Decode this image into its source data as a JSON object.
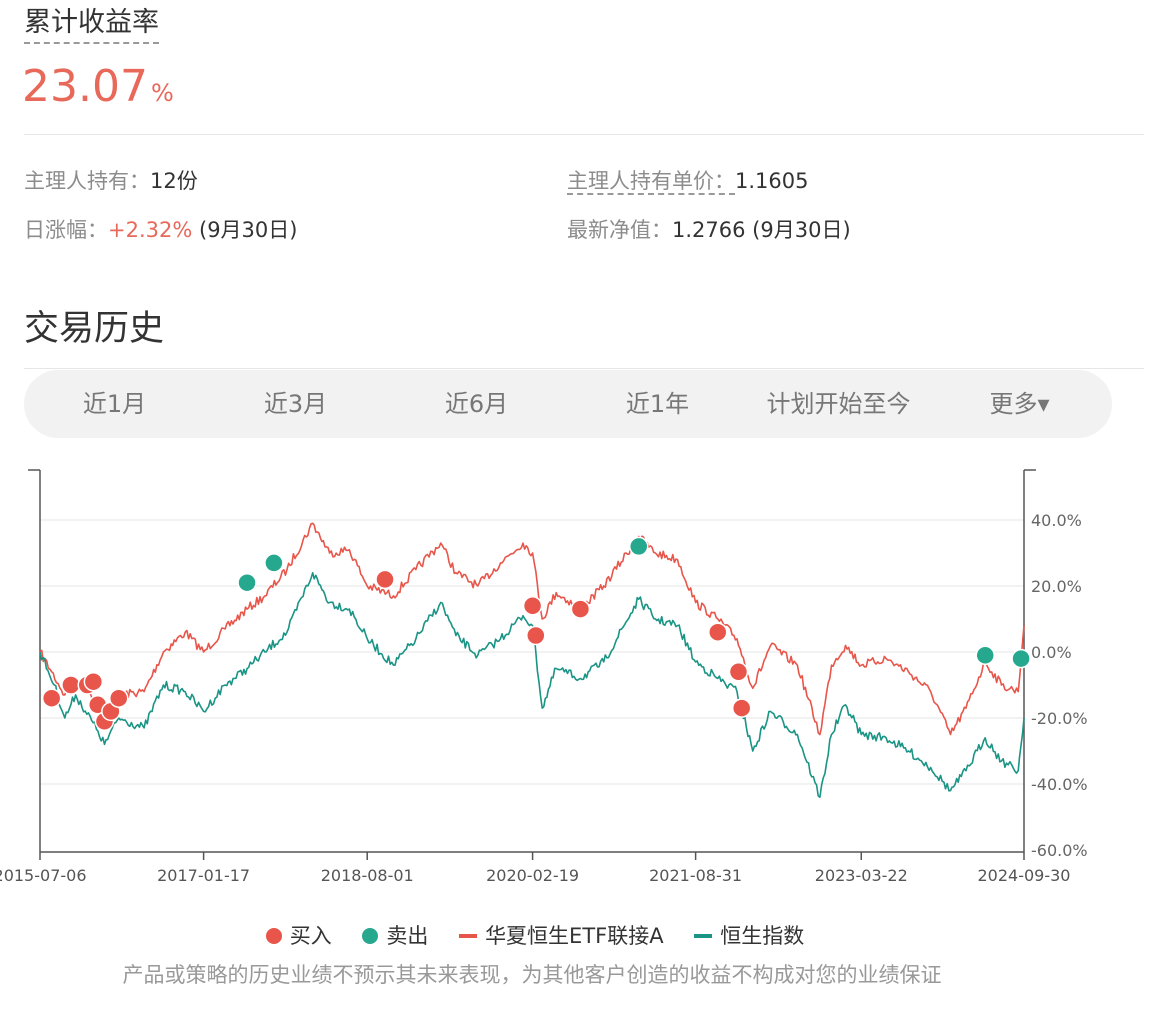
{
  "summary": {
    "title": "累计收益率",
    "return_value": "23.07",
    "return_unit": "%"
  },
  "stats": {
    "holding_label": "主理人持有：",
    "holding_value": "12份",
    "unit_price_label": "主理人持有单价：",
    "unit_price_value": "1.1605",
    "daily_label": "日涨幅：",
    "daily_value": "+2.32%",
    "daily_date": "(9月30日)",
    "nav_label": "最新净值：",
    "nav_value": "1.2766",
    "nav_date": "(9月30日)"
  },
  "section_title": "交易历史",
  "tabs": [
    "近1月",
    "近3月",
    "近6月",
    "近1年",
    "计划开始至今",
    "更多▾"
  ],
  "legend": {
    "buy": "买入",
    "sell": "卖出",
    "fund": "华夏恒生ETF联接A",
    "index": "恒生指数"
  },
  "disclaimer": "产品或策略的历史业绩不预示其未来表现，为其他客户创造的收益不构成对您的业绩保证",
  "colors": {
    "fund": "#e8554a",
    "index": "#1a9485",
    "buy": "#e8554a",
    "sell": "#26a88f",
    "accent": "#e8685a"
  },
  "chart_data": {
    "type": "line",
    "x_ticks": [
      "2015-07-06",
      "2017-01-17",
      "2018-08-01",
      "2020-02-19",
      "2021-08-31",
      "2023-03-22",
      "2024-09-30"
    ],
    "y_ticks": [
      "40.0%",
      "20.0%",
      "0.0%",
      "-20.0%",
      "-40.0%",
      "-60.0%"
    ],
    "y_range": [
      -60,
      40
    ],
    "grid": true,
    "series": [
      {
        "name": "华夏恒生ETF联接A",
        "points": [
          [
            "2015-07-06",
            0
          ],
          [
            "2015-08-15",
            -6
          ],
          [
            "2015-09-29",
            -13
          ],
          [
            "2015-11-05",
            -8
          ],
          [
            "2016-01-12",
            -14
          ],
          [
            "2016-02-12",
            -20
          ],
          [
            "2016-04-01",
            -13
          ],
          [
            "2016-06-27",
            -12
          ],
          [
            "2016-09-01",
            0
          ],
          [
            "2016-11-15",
            6
          ],
          [
            "2017-01-17",
            0
          ],
          [
            "2017-04-01",
            7
          ],
          [
            "2017-06-15",
            13
          ],
          [
            "2017-08-15",
            17
          ],
          [
            "2017-10-30",
            25
          ],
          [
            "2018-01-26",
            39
          ],
          [
            "2018-03-25",
            30
          ],
          [
            "2018-06-01",
            31
          ],
          [
            "2018-08-01",
            20
          ],
          [
            "2018-10-30",
            17
          ],
          [
            "2019-01-15",
            25
          ],
          [
            "2019-04-10",
            33
          ],
          [
            "2019-06-01",
            24
          ],
          [
            "2019-08-15",
            20
          ],
          [
            "2019-11-01",
            27
          ],
          [
            "2020-01-17",
            33
          ],
          [
            "2020-02-19",
            30
          ],
          [
            "2020-03-23",
            10
          ],
          [
            "2020-05-10",
            18
          ],
          [
            "2020-08-01",
            13
          ],
          [
            "2020-10-20",
            20
          ],
          [
            "2021-02-17",
            35
          ],
          [
            "2021-04-15",
            30
          ],
          [
            "2021-06-30",
            28
          ],
          [
            "2021-08-31",
            15
          ],
          [
            "2021-11-15",
            10
          ],
          [
            "2022-01-20",
            4
          ],
          [
            "2022-03-15",
            -11
          ],
          [
            "2022-05-15",
            2
          ],
          [
            "2022-08-15",
            -4
          ],
          [
            "2022-10-31",
            -25
          ],
          [
            "2022-12-10",
            -4
          ],
          [
            "2023-01-27",
            2
          ],
          [
            "2023-03-22",
            -4
          ],
          [
            "2023-06-15",
            -2
          ],
          [
            "2023-08-31",
            -6
          ],
          [
            "2023-11-15",
            -12
          ],
          [
            "2024-01-22",
            -25
          ],
          [
            "2024-03-15",
            -17
          ],
          [
            "2024-05-20",
            -3
          ],
          [
            "2024-07-15",
            -10
          ],
          [
            "2024-09-10",
            -12
          ],
          [
            "2024-09-30",
            8
          ]
        ]
      },
      {
        "name": "恒生指数",
        "points": [
          [
            "2015-07-06",
            0
          ],
          [
            "2015-08-24",
            -10
          ],
          [
            "2015-09-29",
            -20
          ],
          [
            "2015-11-05",
            -13
          ],
          [
            "2016-01-21",
            -24
          ],
          [
            "2016-02-12",
            -28
          ],
          [
            "2016-04-01",
            -20
          ],
          [
            "2016-06-27",
            -23
          ],
          [
            "2016-09-01",
            -10
          ],
          [
            "2016-11-15",
            -12
          ],
          [
            "2017-01-17",
            -18
          ],
          [
            "2017-04-01",
            -10
          ],
          [
            "2017-06-15",
            -5
          ],
          [
            "2017-08-15",
            0
          ],
          [
            "2017-10-30",
            6
          ],
          [
            "2018-01-26",
            24
          ],
          [
            "2018-03-25",
            15
          ],
          [
            "2018-06-01",
            13
          ],
          [
            "2018-08-01",
            4
          ],
          [
            "2018-10-30",
            -4
          ],
          [
            "2019-01-15",
            4
          ],
          [
            "2019-04-10",
            15
          ],
          [
            "2019-06-01",
            5
          ],
          [
            "2019-08-15",
            -1
          ],
          [
            "2019-11-01",
            4
          ],
          [
            "2020-01-17",
            11
          ],
          [
            "2020-02-19",
            8
          ],
          [
            "2020-03-23",
            -17
          ],
          [
            "2020-05-10",
            -5
          ],
          [
            "2020-08-01",
            -8
          ],
          [
            "2020-10-20",
            -3
          ],
          [
            "2021-02-17",
            16
          ],
          [
            "2021-04-15",
            10
          ],
          [
            "2021-06-30",
            8
          ],
          [
            "2021-08-31",
            -3
          ],
          [
            "2021-11-15",
            -8
          ],
          [
            "2022-01-20",
            -12
          ],
          [
            "2022-03-15",
            -30
          ],
          [
            "2022-05-15",
            -18
          ],
          [
            "2022-08-15",
            -25
          ],
          [
            "2022-10-31",
            -44
          ],
          [
            "2022-12-10",
            -25
          ],
          [
            "2023-01-27",
            -16
          ],
          [
            "2023-03-22",
            -25
          ],
          [
            "2023-06-15",
            -26
          ],
          [
            "2023-08-31",
            -30
          ],
          [
            "2023-11-15",
            -35
          ],
          [
            "2024-01-22",
            -42
          ],
          [
            "2024-03-15",
            -36
          ],
          [
            "2024-05-20",
            -26
          ],
          [
            "2024-07-15",
            -33
          ],
          [
            "2024-09-10",
            -36
          ],
          [
            "2024-09-30",
            -20
          ]
        ]
      }
    ],
    "buy_points": [
      [
        "2015-08-15",
        -14
      ],
      [
        "2015-10-20",
        -10
      ],
      [
        "2015-12-15",
        -10
      ],
      [
        "2016-01-05",
        -9
      ],
      [
        "2016-01-20",
        -16
      ],
      [
        "2016-02-12",
        -21
      ],
      [
        "2016-03-05",
        -18
      ],
      [
        "2016-04-01",
        -14
      ],
      [
        "2018-10-01",
        22
      ],
      [
        "2020-02-19",
        14
      ],
      [
        "2020-03-01",
        5
      ],
      [
        "2020-08-01",
        13
      ],
      [
        "2021-11-15",
        6
      ],
      [
        "2022-01-25",
        -6
      ],
      [
        "2022-02-05",
        -17
      ]
    ],
    "sell_points": [
      [
        "2017-06-15",
        21
      ],
      [
        "2017-09-15",
        27
      ],
      [
        "2021-02-17",
        32
      ],
      [
        "2024-05-20",
        -1
      ],
      [
        "2024-09-20",
        -2
      ]
    ]
  }
}
